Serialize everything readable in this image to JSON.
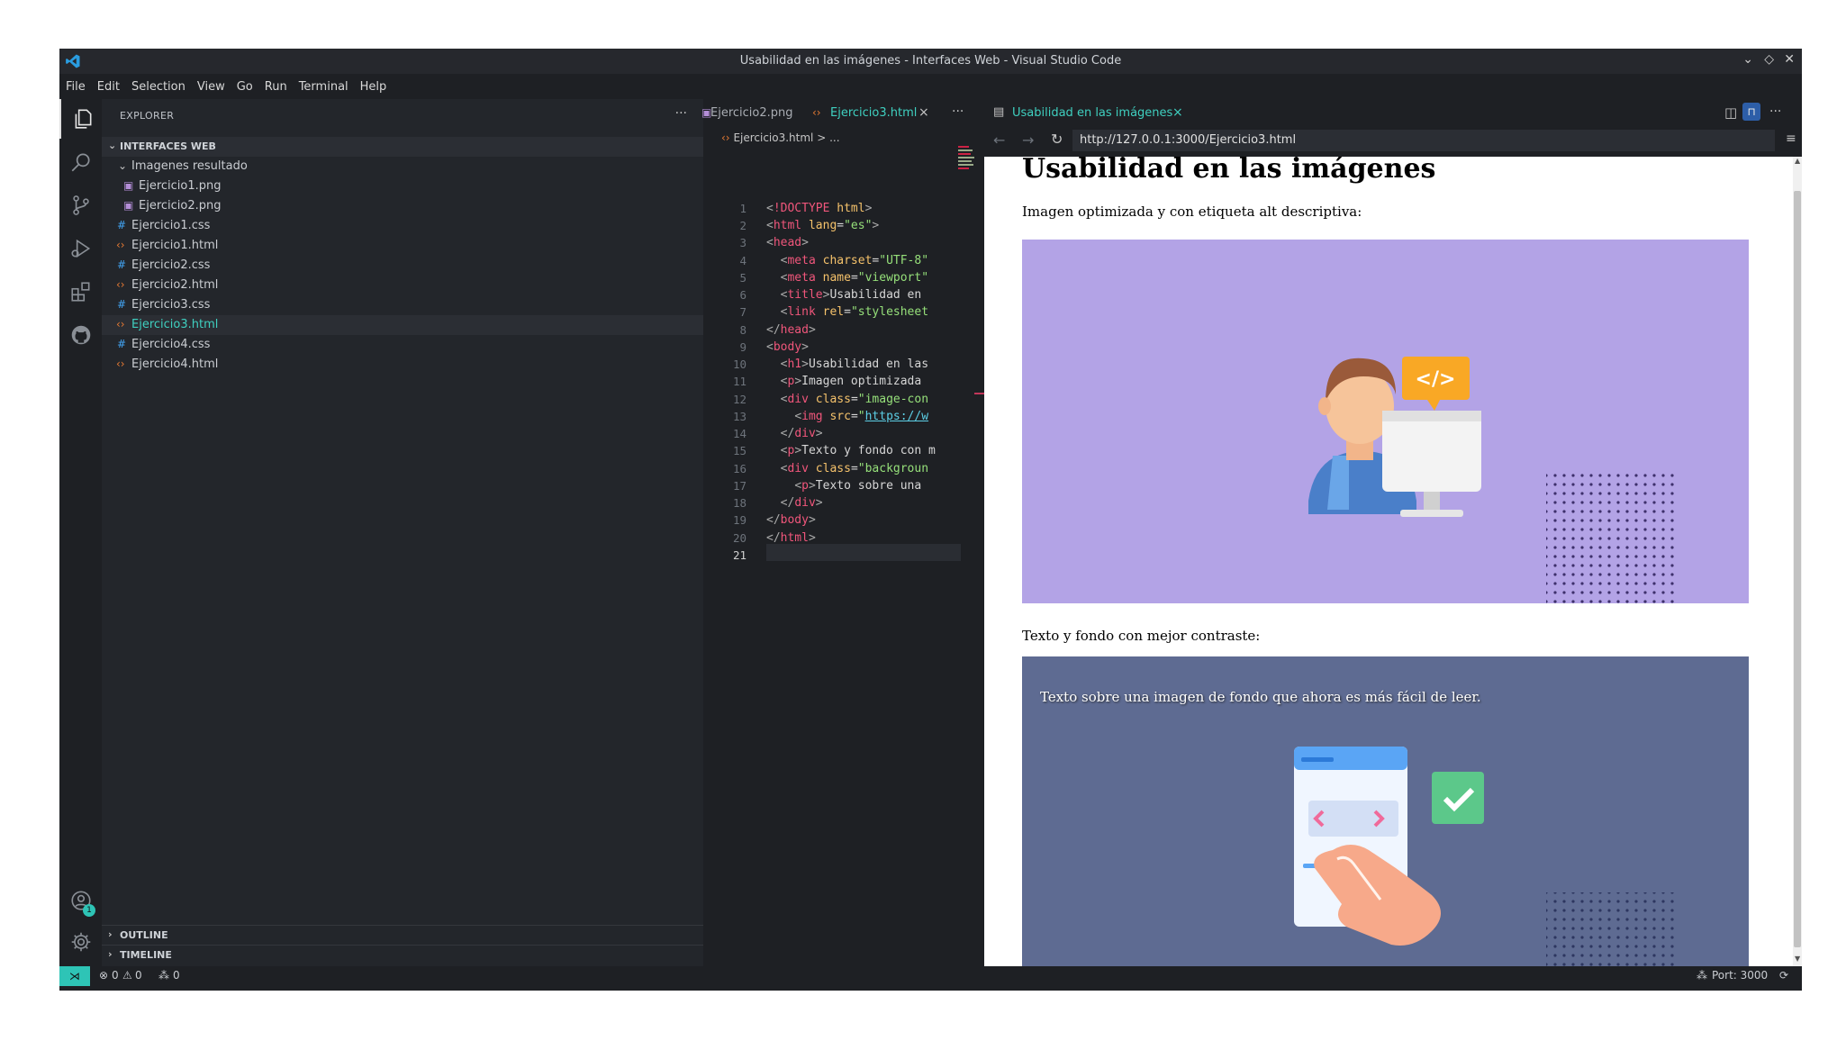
{
  "window": {
    "title": "Usabilidad en las imágenes - Interfaces Web - Visual Studio Code",
    "controls": [
      "⌄",
      "◇",
      "✕"
    ]
  },
  "menu": [
    "File",
    "Edit",
    "Selection",
    "View",
    "Go",
    "Run",
    "Terminal",
    "Help"
  ],
  "activity_icons": [
    "files-icon",
    "search-icon",
    "source-control-icon",
    "run-debug-icon",
    "extensions-icon",
    "github-icon"
  ],
  "accounts_badge": "1",
  "sidebar": {
    "header": "EXPLORER",
    "more": "···",
    "folder": "INTERFACES WEB",
    "subfolder": "Imagenes resultado",
    "files": [
      {
        "name": "Ejercicio1.png",
        "type": "png"
      },
      {
        "name": "Ejercicio2.png",
        "type": "png"
      },
      {
        "name": "Ejercicio1.css",
        "type": "css"
      },
      {
        "name": "Ejercicio1.html",
        "type": "html"
      },
      {
        "name": "Ejercicio2.css",
        "type": "css"
      },
      {
        "name": "Ejercicio2.html",
        "type": "html"
      },
      {
        "name": "Ejercicio3.css",
        "type": "css"
      },
      {
        "name": "Ejercicio3.html",
        "type": "html",
        "selected": true
      },
      {
        "name": "Ejercicio4.css",
        "type": "css"
      },
      {
        "name": "Ejercicio4.html",
        "type": "html"
      }
    ],
    "outline": "OUTLINE",
    "timeline": "TIMELINE"
  },
  "editor": {
    "tabs": [
      {
        "label": "Ejercicio2.png",
        "active": false
      },
      {
        "label": "Ejercicio3.html",
        "active": true
      }
    ],
    "more": "···",
    "breadcrumb": "Ejercicio3.html > ...",
    "line_numbers": [
      "1",
      "2",
      "3",
      "4",
      "5",
      "6",
      "7",
      "8",
      "9",
      "10",
      "11",
      "12",
      "13",
      "14",
      "15",
      "16",
      "17",
      "18",
      "19",
      "20",
      "21"
    ]
  },
  "preview": {
    "tab": "Usabilidad en las imágenes",
    "url": "http://127.0.0.1:3000/Ejercicio3.html",
    "heading": "Usabilidad en las imágenes",
    "p1": "Imagen optimizada y con etiqueta alt descriptiva:",
    "p2": "Texto y fondo con mejor contraste:",
    "overlay_text": "Texto sobre una imagen de fondo que ahora es más fácil de leer.",
    "code_badge": "</>"
  },
  "status": {
    "errors": "0",
    "warnings": "0",
    "ports": "0",
    "port_label": "Port: 3000"
  },
  "colors": {
    "accent": "#3fd0c0",
    "image_bg": "#b3a3e6",
    "contrast_bg": "#5e6b92"
  }
}
